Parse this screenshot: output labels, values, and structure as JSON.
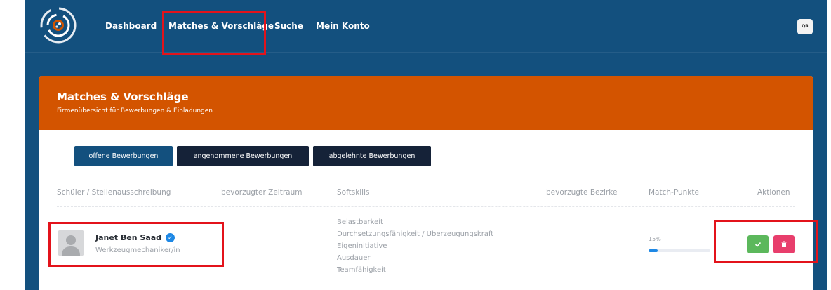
{
  "nav": {
    "items": [
      {
        "label": "Dashboard"
      },
      {
        "label": "Matches & Vorschläge"
      },
      {
        "label": "Suche"
      },
      {
        "label": "Mein Konto"
      }
    ],
    "qr_label": "QR"
  },
  "card": {
    "title": "Matches & Vorschläge",
    "subtitle": "Firmenübersicht für Bewerbungen & Einladungen",
    "tabs": [
      {
        "label": "offene Bewerbungen",
        "active": true
      },
      {
        "label": "angenommene Bewerbungen",
        "active": false
      },
      {
        "label": "abgelehnte Bewerbungen",
        "active": false
      }
    ]
  },
  "table": {
    "headers": {
      "student": "Schüler / Stellenausschreibung",
      "period": "bevorzugter Zeitraum",
      "softskills": "Softskills",
      "districts": "bevorzugte Bezirke",
      "points": "Match-Punkte",
      "actions": "Aktionen"
    },
    "rows": [
      {
        "name": "Janet Ben Saad",
        "verified": true,
        "job": "Werkzeugmechaniker/in",
        "softskills": [
          "Belastbarkeit",
          "Durchsetzungsfähigkeit / Überzeugungskraft",
          "Eigeninitiative",
          "Ausdauer",
          "Teamfähigkeit"
        ],
        "match_percent": "15%",
        "match_value": 15
      }
    ]
  },
  "colors": {
    "header_bg": "#13507e",
    "card_header": "#d35400",
    "tab_active": "#13507e",
    "tab_inactive": "#152238",
    "accept": "#5cb85c",
    "delete": "#e83e6c",
    "progress": "#1e88e5",
    "highlight": "#e3131b"
  },
  "icons": {
    "logo": "circular-logo-icon",
    "verified": "check-badge-icon",
    "accept": "check-icon",
    "delete": "trash-icon",
    "avatar": "person-placeholder-icon"
  }
}
